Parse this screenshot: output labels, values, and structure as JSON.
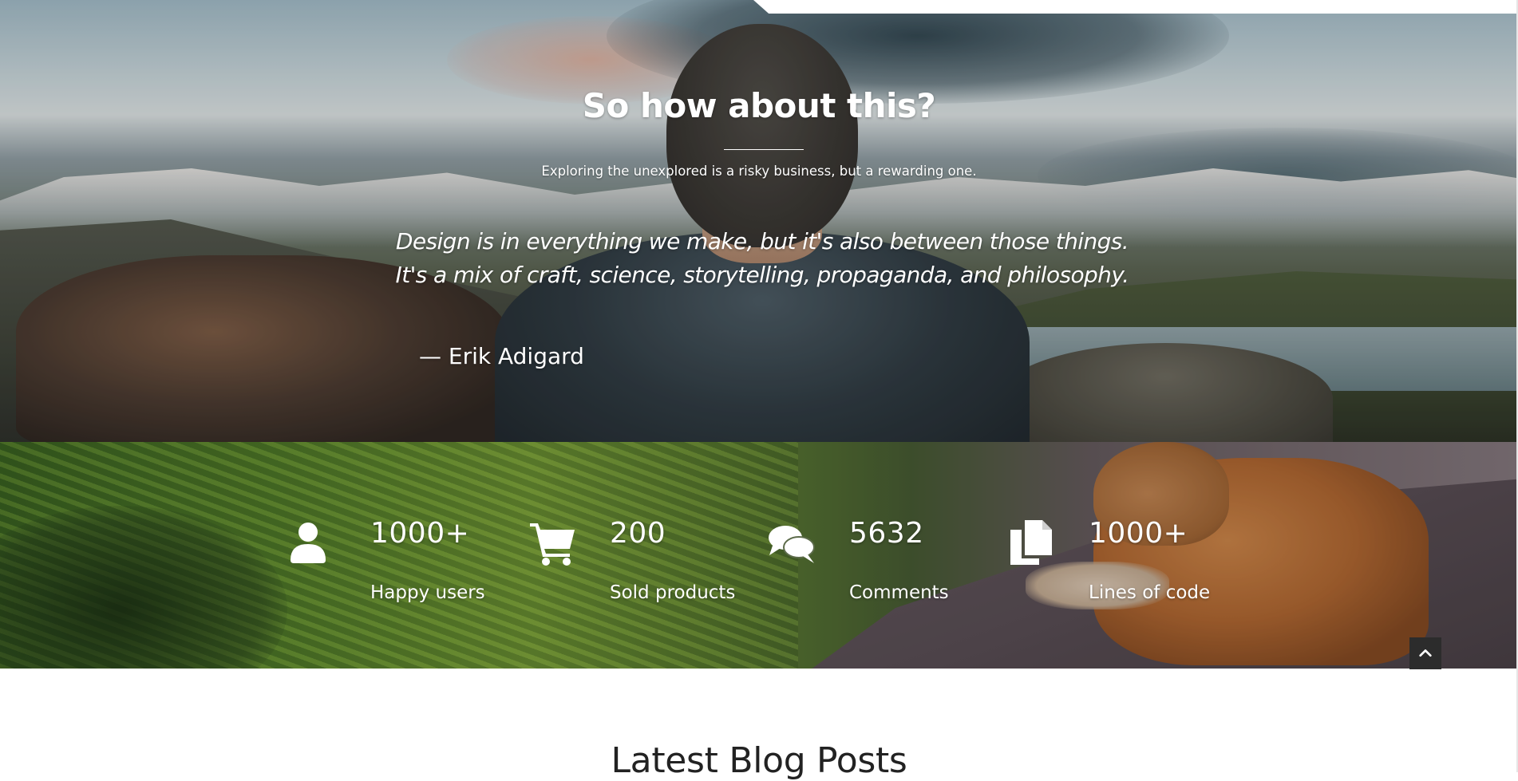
{
  "hero": {
    "title": "So how about this?",
    "subtitle": "Exploring the unexplored is a risky business, but a rewarding one.",
    "quote": {
      "lines": [
        "Design is in everything we make, but it's also between those things.",
        "It's a mix of craft, science, storytelling, propaganda, and philosophy."
      ],
      "author": "— Erik Adigard"
    }
  },
  "stats": [
    {
      "icon": "user-icon",
      "value": "1000+",
      "label": "Happy users"
    },
    {
      "icon": "shopping-cart-icon",
      "value": "200",
      "label": "Sold products"
    },
    {
      "icon": "comments-icon",
      "value": "5632",
      "label": "Comments"
    },
    {
      "icon": "copy-files-icon",
      "value": "1000+",
      "label": "Lines of code"
    }
  ],
  "scroll_top": {
    "icon": "chevron-up-icon"
  },
  "blog": {
    "title": "Latest Blog Posts"
  },
  "colors": {
    "text_light": "#ffffff",
    "heading_dark": "#222222",
    "scroll_button": "#2c2c2c"
  }
}
